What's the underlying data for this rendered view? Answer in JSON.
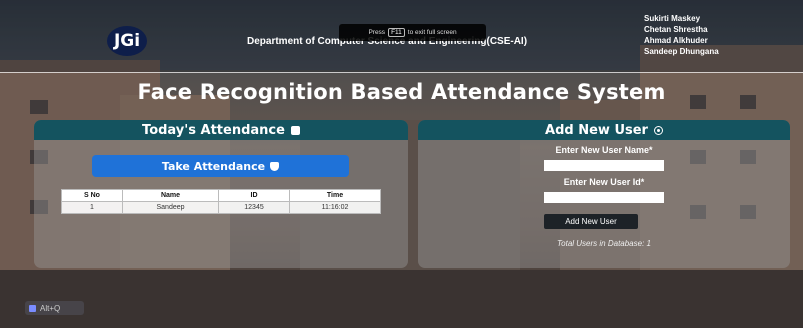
{
  "header": {
    "logo_text": "JGi",
    "department": "Department of Computer Science and Engineering(CSE-AI)",
    "team": [
      "Sukirti Maskey",
      "Chetan Shrestha",
      "Ahmad Alkhuder",
      "Sandeep Dhungana"
    ],
    "fullscreen_notice": {
      "prefix": "Press",
      "key": "F11",
      "suffix": "to exit full screen"
    }
  },
  "page_title": "Face Recognition Based Attendance System",
  "attendance": {
    "heading": "Today's Attendance",
    "heading_icon": "clipboard-icon",
    "take_button": "Take Attendance",
    "take_icon": "shield-check-icon",
    "columns": [
      "S No",
      "Name",
      "ID",
      "Time"
    ],
    "rows": [
      [
        "1",
        "Sandeep",
        "12345",
        "11:16:02"
      ]
    ]
  },
  "add_user": {
    "heading": "Add New User",
    "heading_icon": "eye-icon",
    "name_label": "Enter New User Name*",
    "name_value": "",
    "id_label": "Enter New User Id*",
    "id_value": "",
    "button": "Add New User",
    "total": "Total Users in Database: 1"
  },
  "shortcut_badge": "Alt+Q",
  "colors": {
    "panel_header": "#14535f",
    "primary_button": "#1f72d8",
    "dark_button": "#1d2227"
  }
}
